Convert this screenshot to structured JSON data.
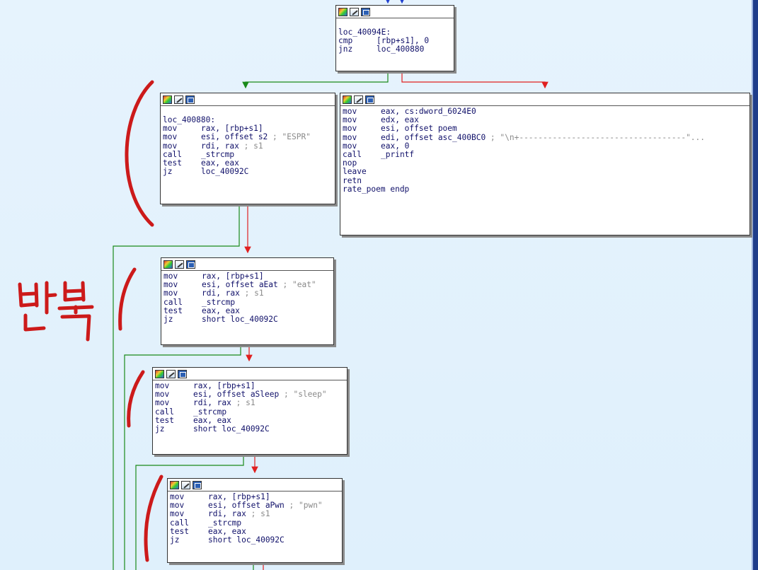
{
  "annotation_text": "반복",
  "nodes": {
    "n1": {
      "lines": [
        {
          "label": "loc_40094E:"
        },
        {
          "mn": "cmp",
          "op": "[rbp+s1], 0"
        },
        {
          "mn": "jnz",
          "op": "loc_400880"
        }
      ]
    },
    "n2": {
      "lines": [
        {
          "label": "loc_400880:"
        },
        {
          "mn": "mov",
          "op": "rax, [rbp+s1]"
        },
        {
          "mn": "mov",
          "op": "esi, offset s2",
          "cm": "; \"ESPR\""
        },
        {
          "mn": "mov",
          "op": "rdi, rax",
          "cm": "; s1"
        },
        {
          "mn": "call",
          "op": "_strcmp"
        },
        {
          "mn": "test",
          "op": "eax, eax"
        },
        {
          "mn": "jz",
          "op": "loc_40092C"
        }
      ]
    },
    "n3": {
      "lines": [
        {
          "mn": "mov",
          "op": "eax, cs:dword_6024E0"
        },
        {
          "mn": "mov",
          "op": "edx, eax"
        },
        {
          "mn": "mov",
          "op": "esi, offset poem"
        },
        {
          "mn": "mov",
          "op": "edi, offset asc_400BC0",
          "cm": "; \"\\n+-----------------------------------\"..."
        },
        {
          "mn": "mov",
          "op": "eax, 0"
        },
        {
          "mn": "call",
          "op": "_printf"
        },
        {
          "mn": "nop",
          "op": ""
        },
        {
          "mn": "leave",
          "op": ""
        },
        {
          "mn": "retn",
          "op": ""
        },
        {
          "label": "rate_poem endp"
        }
      ]
    },
    "n4": {
      "lines": [
        {
          "mn": "mov",
          "op": "rax, [rbp+s1]"
        },
        {
          "mn": "mov",
          "op": "esi, offset aEat",
          "cm": "; \"eat\""
        },
        {
          "mn": "mov",
          "op": "rdi, rax",
          "cm": "; s1"
        },
        {
          "mn": "call",
          "op": "_strcmp"
        },
        {
          "mn": "test",
          "op": "eax, eax"
        },
        {
          "mn": "jz",
          "op": "short loc_40092C"
        }
      ]
    },
    "n5": {
      "lines": [
        {
          "mn": "mov",
          "op": "rax, [rbp+s1]"
        },
        {
          "mn": "mov",
          "op": "esi, offset aSleep",
          "cm": "; \"sleep\""
        },
        {
          "mn": "mov",
          "op": "rdi, rax",
          "cm": "; s1"
        },
        {
          "mn": "call",
          "op": "_strcmp"
        },
        {
          "mn": "test",
          "op": "eax, eax"
        },
        {
          "mn": "jz",
          "op": "short loc_40092C"
        }
      ]
    },
    "n6": {
      "lines": [
        {
          "mn": "mov",
          "op": "rax, [rbp+s1]"
        },
        {
          "mn": "mov",
          "op": "esi, offset aPwn",
          "cm": "; \"pwn\""
        },
        {
          "mn": "mov",
          "op": "rdi, rax",
          "cm": "; s1"
        },
        {
          "mn": "call",
          "op": "_strcmp"
        },
        {
          "mn": "test",
          "op": "eax, eax"
        },
        {
          "mn": "jz",
          "op": "short loc_40092C"
        }
      ]
    }
  },
  "colors": {
    "true_edge": "#1a8a1a",
    "false_edge": "#e02020",
    "flow_edge": "#1f3fd0",
    "annotation": "#cc1a1a"
  }
}
